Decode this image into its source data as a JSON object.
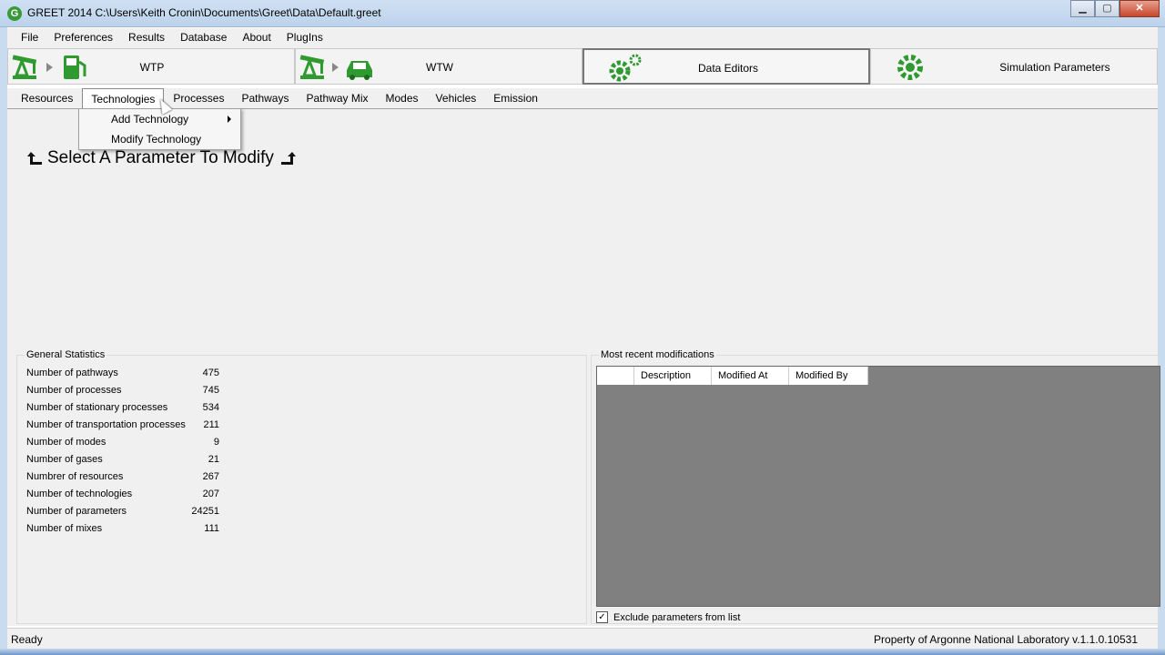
{
  "window": {
    "title": "GREET 2014   C:\\Users\\Keith Cronin\\Documents\\Greet\\Data\\Default.greet",
    "minimize": "▁",
    "maximize": "▢",
    "close": "✕"
  },
  "menu": [
    "File",
    "Preferences",
    "Results",
    "Database",
    "About",
    "PlugIns"
  ],
  "toolbar": {
    "wtp": "WTP",
    "wtw": "WTW",
    "data_editors": "Data Editors",
    "simulation_parameters": "Simulation Parameters"
  },
  "tabs": [
    "Resources",
    "Technologies",
    "Processes",
    "Pathways",
    "Pathway Mix",
    "Modes",
    "Vehicles",
    "Emission"
  ],
  "dropdown": {
    "add_technology": "Add Technology",
    "modify_technology": "Modify Technology"
  },
  "main": {
    "select_param": "Select A Parameter To Modify"
  },
  "general_statistics": {
    "title": "General Statistics",
    "rows": [
      {
        "label": "Number of pathways",
        "value": "475"
      },
      {
        "label": "Number of processes",
        "value": "745"
      },
      {
        "label": "Number of stationary processes",
        "value": "534"
      },
      {
        "label": "Number of transportation processes",
        "value": "211"
      },
      {
        "label": "Number of modes",
        "value": "9"
      },
      {
        "label": "Number of gases",
        "value": "21"
      },
      {
        "label": "Numbrer of resources",
        "value": "267"
      },
      {
        "label": "Number of technologies",
        "value": "207"
      },
      {
        "label": "Number of parameters",
        "value": "24251"
      },
      {
        "label": "Number of mixes",
        "value": "111"
      }
    ]
  },
  "recent": {
    "title": "Most recent modifications",
    "columns": [
      "Description",
      "Modified At",
      "Modified By"
    ],
    "exclude_label": "Exclude parameters from list",
    "exclude_checked": "✓"
  },
  "status": {
    "left": "Ready",
    "right": "Property of Argonne National Laboratory v.1.1.0.10531"
  },
  "colors": {
    "accent_green": "#2f9a2f",
    "grid_gray": "#808080"
  }
}
